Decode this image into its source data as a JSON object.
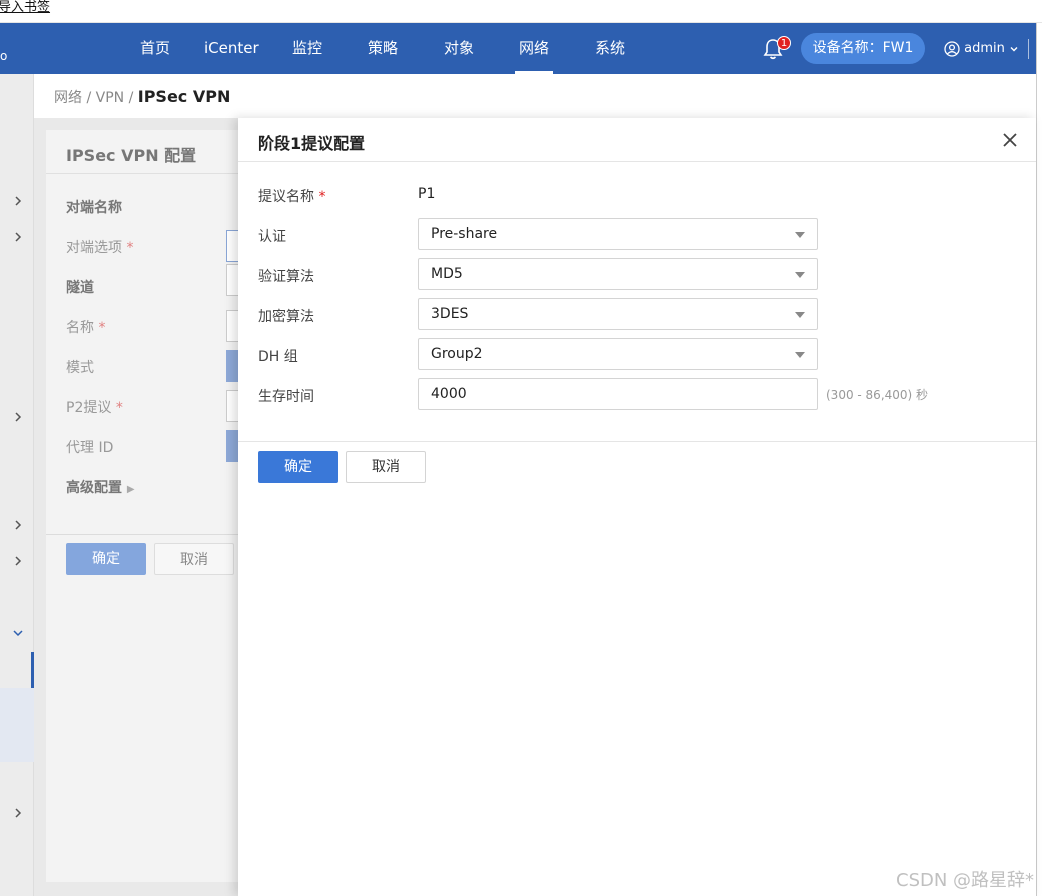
{
  "bookmark_bar": {
    "import_label": "导入书签"
  },
  "nav": {
    "edge_glyph": "o",
    "items": [
      {
        "label": "首页"
      },
      {
        "label": "iCenter"
      },
      {
        "label": "监控"
      },
      {
        "label": "策略"
      },
      {
        "label": "对象"
      },
      {
        "label": "网络",
        "active": true
      },
      {
        "label": "系统"
      }
    ],
    "notification_count": "1",
    "device_label": "设备名称：FW1",
    "user": "admin",
    "colors": {
      "bar": "#2d5fb0",
      "pill": "#4a86dd",
      "badge": "#e02020"
    }
  },
  "breadcrumb": {
    "level1": "网络",
    "sep1": "/",
    "level2": "VPN",
    "sep2": "/",
    "current": "IPSec VPN"
  },
  "background_form": {
    "title": "IPSec VPN 配置",
    "section_peer": "对端名称",
    "peer_option_label": "对端选项",
    "section_tunnel": "隧道",
    "name_label": "名称",
    "mode_label": "模式",
    "p2_label": "P2提议",
    "proxy_label": "代理 ID",
    "advanced_label": "高级配置",
    "required_mark": "*",
    "ok_label": "确定",
    "cancel_label": "取消"
  },
  "drawer": {
    "title": "阶段1提议配置",
    "required_mark": "*",
    "fields": {
      "name": {
        "label": "提议名称",
        "value": "P1"
      },
      "auth": {
        "label": "认证",
        "value": "Pre-share"
      },
      "hash": {
        "label": "验证算法",
        "value": "MD5"
      },
      "encryption": {
        "label": "加密算法",
        "value": "3DES"
      },
      "dh": {
        "label": "DH 组",
        "value": "Group2"
      },
      "lifetime": {
        "label": "生存时间",
        "value": "4000",
        "hint": "(300 - 86,400) 秒"
      }
    },
    "ok_label": "确定",
    "cancel_label": "取消",
    "colors": {
      "primary": "#3a78d8"
    }
  },
  "watermark": "CSDN @路星辞*"
}
